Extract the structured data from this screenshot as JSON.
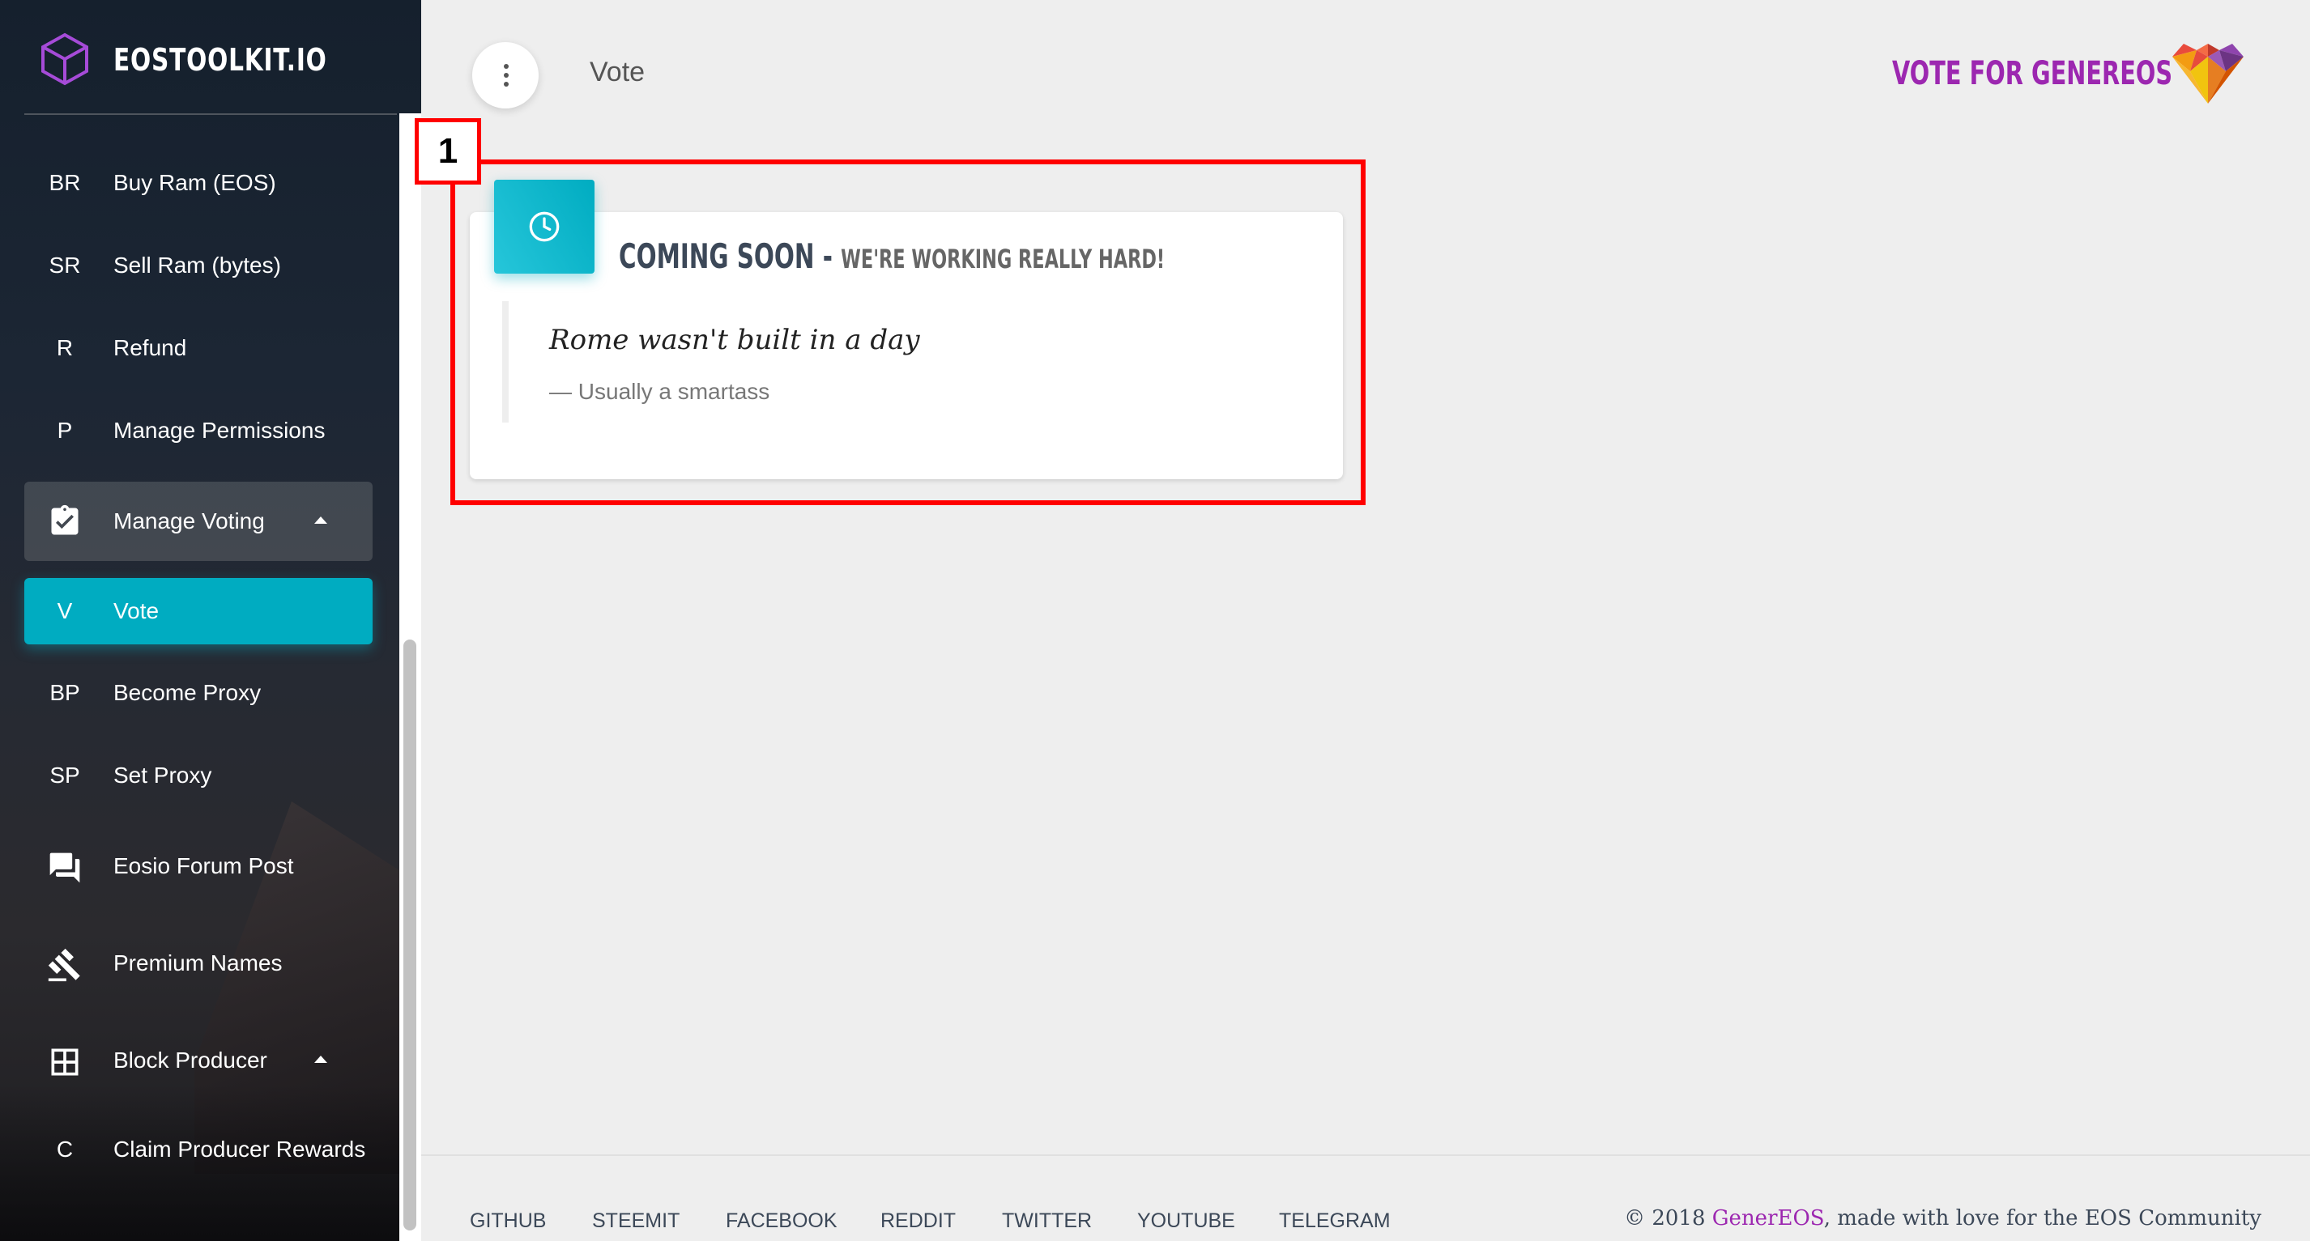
{
  "sidebar": {
    "brand_name": "EOSTOOLKIT.IO",
    "items": [
      {
        "abbr": "BR",
        "label": "Buy Ram (EOS)"
      },
      {
        "abbr": "SR",
        "label": "Sell Ram (bytes)"
      },
      {
        "abbr": "R",
        "label": "Refund"
      },
      {
        "abbr": "P",
        "label": "Manage Permissions"
      }
    ],
    "manage_voting": {
      "label": "Manage Voting",
      "icon": "assignment-turned-in-icon"
    },
    "voting_items": [
      {
        "abbr": "V",
        "label": "Vote",
        "active": true
      },
      {
        "abbr": "BP",
        "label": "Become Proxy"
      },
      {
        "abbr": "SP",
        "label": "Set Proxy"
      }
    ],
    "forum": {
      "label": "Eosio Forum Post",
      "icon": "forum-icon"
    },
    "premium": {
      "label": "Premium Names",
      "icon": "gavel-icon"
    },
    "block_producer": {
      "label": "Block Producer",
      "icon": "dashboard-icon"
    },
    "producer_items": [
      {
        "abbr": "C",
        "label": "Claim Producer Rewards"
      }
    ]
  },
  "header": {
    "page_title": "Vote",
    "vote_link": "VOTE FOR GENEREOS"
  },
  "card": {
    "marker": "1",
    "title": "COMING SOON - ",
    "subtitle": "WE'RE WORKING REALLY HARD!",
    "quote": "Rome wasn't built in a day",
    "author": "— Usually a smartass",
    "icon": "clock-icon"
  },
  "footer": {
    "links": [
      "GITHUB",
      "STEEMIT",
      "FACEBOOK",
      "REDDIT",
      "TWITTER",
      "YOUTUBE",
      "TELEGRAM"
    ],
    "copyright_prefix": "© 2018 ",
    "copyright_brand": "GenerEOS",
    "copyright_suffix": ", made with love for the EOS Community"
  },
  "colors": {
    "accent": "#00acc1",
    "brand_purple": "#9c27b0",
    "highlight": "#ff0000"
  }
}
